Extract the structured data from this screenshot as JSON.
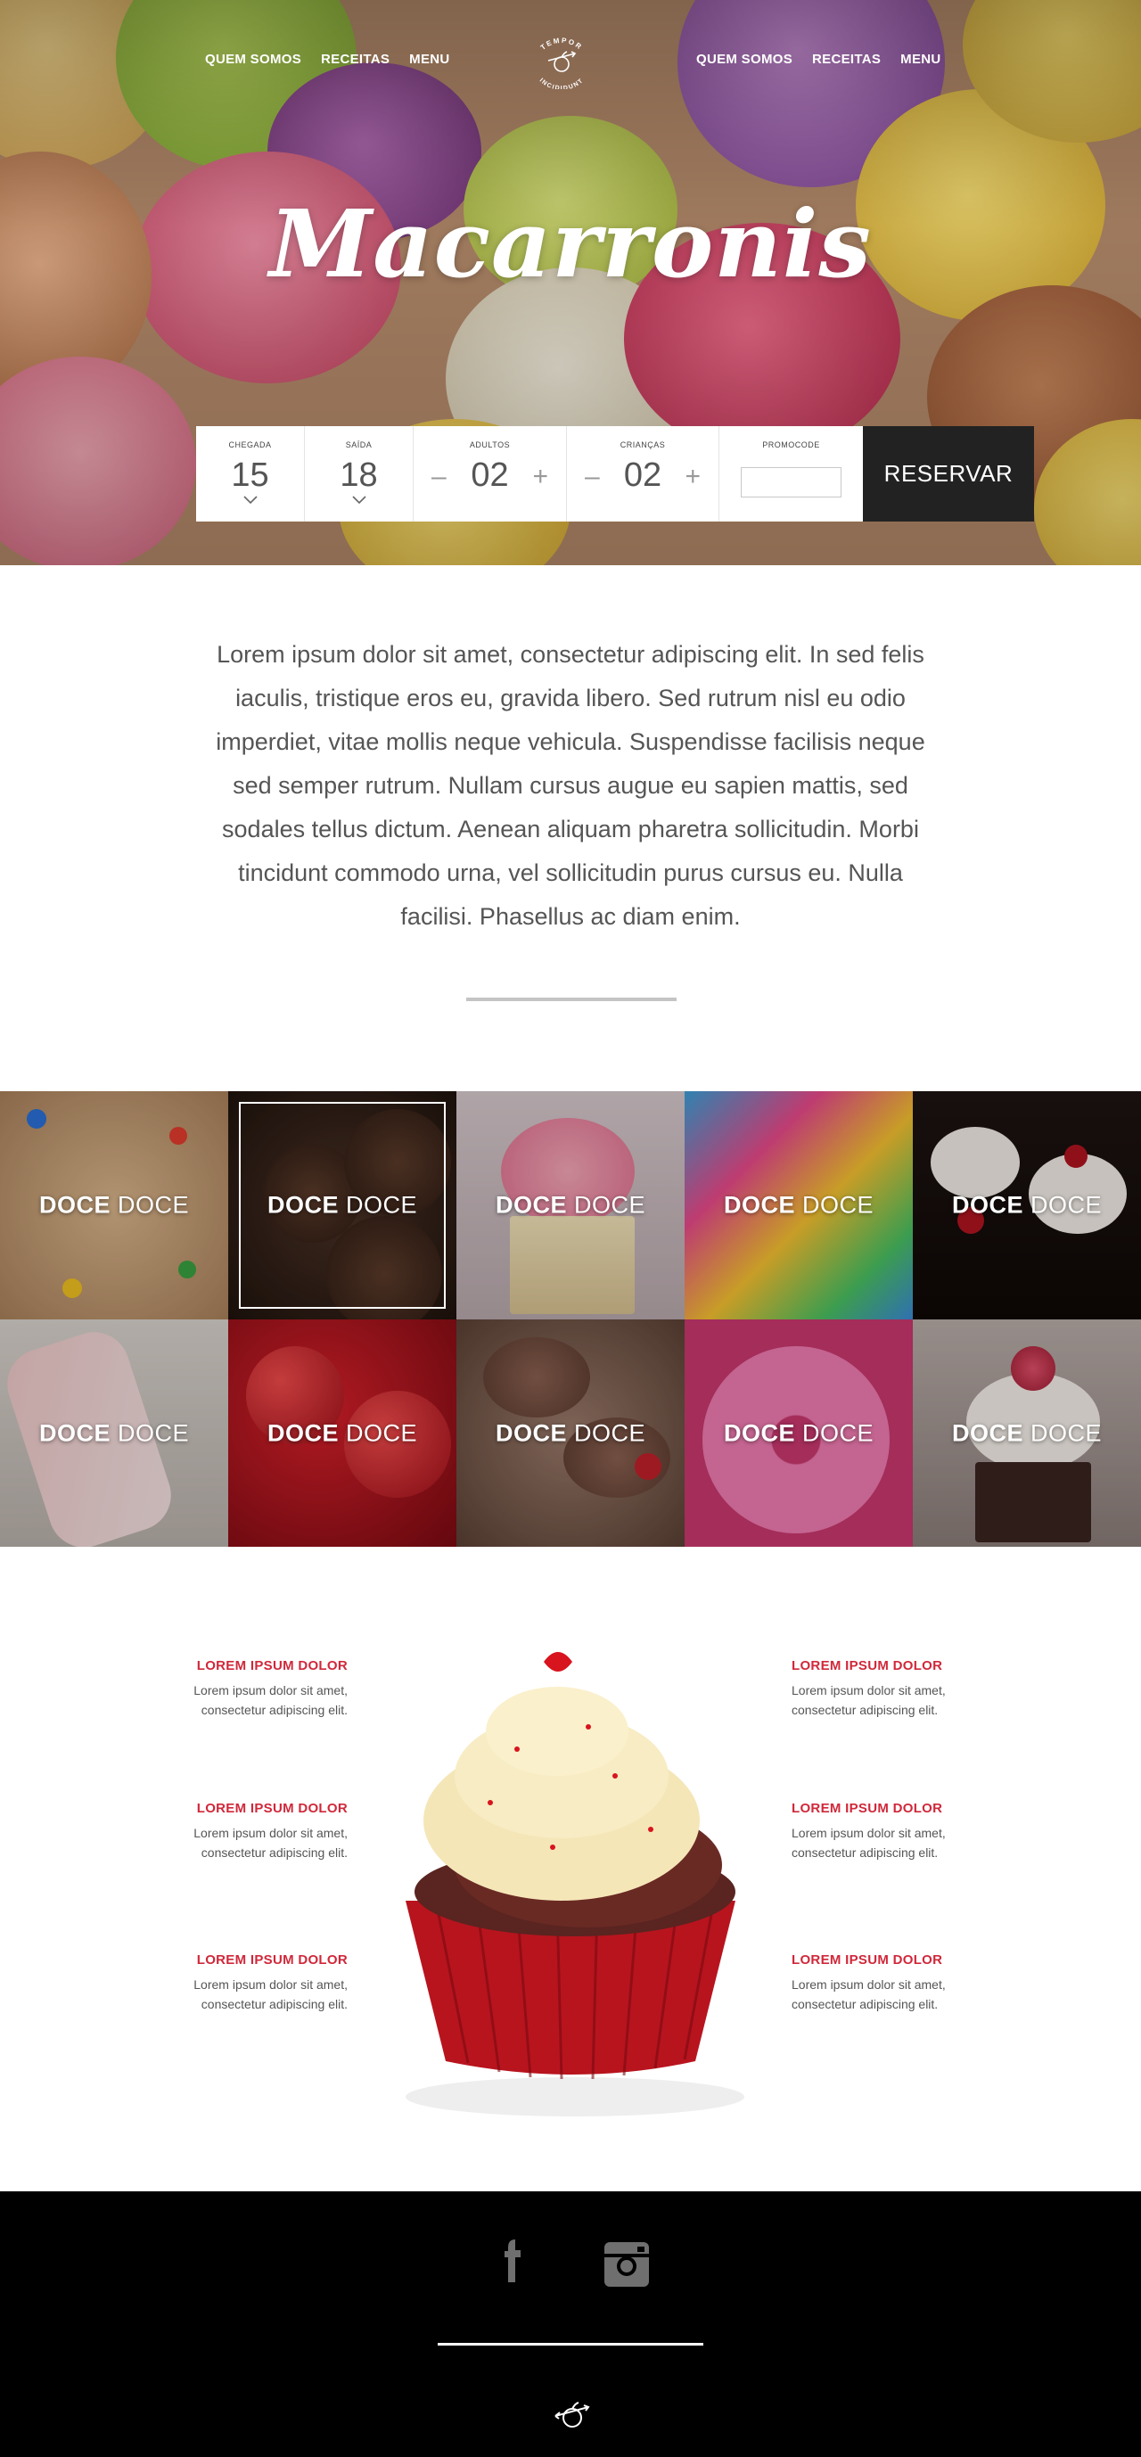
{
  "nav": {
    "left": [
      "QUEM SOMOS",
      "RECEITAS",
      "MENU"
    ],
    "right": [
      "QUEM SOMOS",
      "RECEITAS",
      "MENU"
    ]
  },
  "logo": {
    "top_text": "TEMPOR",
    "bottom_text": "INCIDIDUNT"
  },
  "hero": {
    "title": "Macarronis"
  },
  "booking": {
    "chegada": {
      "label": "CHEGADA",
      "value": "15"
    },
    "saida": {
      "label": "SAÍDA",
      "value": "18"
    },
    "adultos": {
      "label": "ADULTOS",
      "value": "02",
      "minus": "–",
      "plus": "+"
    },
    "criancas": {
      "label": "CRIANÇAS",
      "value": "02",
      "minus": "–",
      "plus": "+"
    },
    "promocode": {
      "label": "PROMOCODE",
      "value": ""
    },
    "reservar": "RESERVAR"
  },
  "intro": {
    "text": "Lorem ipsum dolor sit amet, consectetur adipiscing elit. In sed felis iaculis, tristique eros eu, gravida libero. Sed rutrum nisl eu odio imperdiet, vitae mollis neque vehicula. Suspendisse facilisis neque sed semper rutrum. Nullam cursus augue eu sapien mattis, sed sodales tellus dictum. Aenean aliquam pharetra sollicitudin. Morbi tincidunt commodo urna, vel sollicitudin purus cursus eu. Nulla facilisi. Phasellus ac diam enim."
  },
  "tiles": [
    {
      "bold": "DOCE",
      "light": "DOCE"
    },
    {
      "bold": "DOCE",
      "light": "DOCE"
    },
    {
      "bold": "DOCE",
      "light": "DOCE"
    },
    {
      "bold": "DOCE",
      "light": "DOCE"
    },
    {
      "bold": "DOCE",
      "light": "DOCE"
    },
    {
      "bold": "DOCE",
      "light": "DOCE"
    },
    {
      "bold": "DOCE",
      "light": "DOCE"
    },
    {
      "bold": "DOCE",
      "light": "DOCE"
    },
    {
      "bold": "DOCE",
      "light": "DOCE"
    },
    {
      "bold": "DOCE",
      "light": "DOCE"
    }
  ],
  "features": {
    "left": [
      {
        "title": "LOREM IPSUM DOLOR",
        "line1": "Lorem ipsum dolor sit amet,",
        "line2": "consectetur adipiscing elit."
      },
      {
        "title": "LOREM IPSUM DOLOR",
        "line1": "Lorem ipsum dolor sit amet,",
        "line2": "consectetur adipiscing elit."
      },
      {
        "title": "LOREM IPSUM DOLOR",
        "line1": "Lorem ipsum dolor sit amet,",
        "line2": "consectetur adipiscing elit."
      }
    ],
    "right": [
      {
        "title": "LOREM IPSUM DOLOR",
        "line1": "Lorem ipsum dolor sit amet,",
        "line2": "consectetur adipiscing elit."
      },
      {
        "title": "LOREM IPSUM DOLOR",
        "line1": "Lorem ipsum dolor sit amet,",
        "line2": "consectetur adipiscing elit."
      },
      {
        "title": "LOREM IPSUM DOLOR",
        "line1": "Lorem ipsum dolor sit amet,",
        "line2": "consectetur adipiscing elit."
      }
    ]
  },
  "footer": {
    "icons": [
      "facebook-icon",
      "instagram-icon"
    ]
  },
  "colors": {
    "accent_red": "#d0283a",
    "footer_bg": "#000000",
    "reservar_bg": "#222222"
  }
}
